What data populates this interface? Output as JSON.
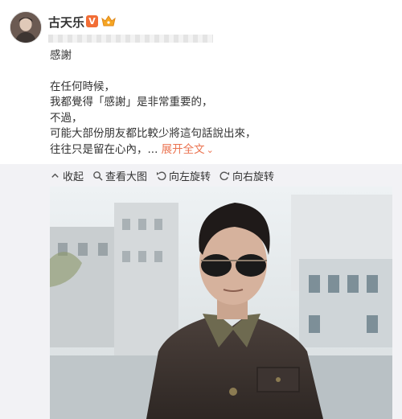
{
  "post": {
    "username": "古天乐",
    "verified_badge": "V",
    "badges": [
      "verified-icon",
      "crown-icon"
    ],
    "text_lines": [
      "感謝",
      "",
      "在任何時候，",
      "我都覺得「感謝」是非常重要的，",
      "不過，",
      "可能大部份朋友都比較少將這句話說出來，"
    ],
    "last_line_text": "往往只是留在心內，...",
    "expand_label": "展开全文",
    "expand_icon": "chevron-down-icon"
  },
  "toolbar": {
    "collect_label": "收起",
    "view_large_label": "查看大图",
    "rotate_left_label": "向左旋转",
    "rotate_right_label": "向右旋转"
  },
  "colors": {
    "accent_orange": "#eb7350",
    "vip_badge": "#f26d35",
    "panel_background": "#f2f2f5"
  }
}
